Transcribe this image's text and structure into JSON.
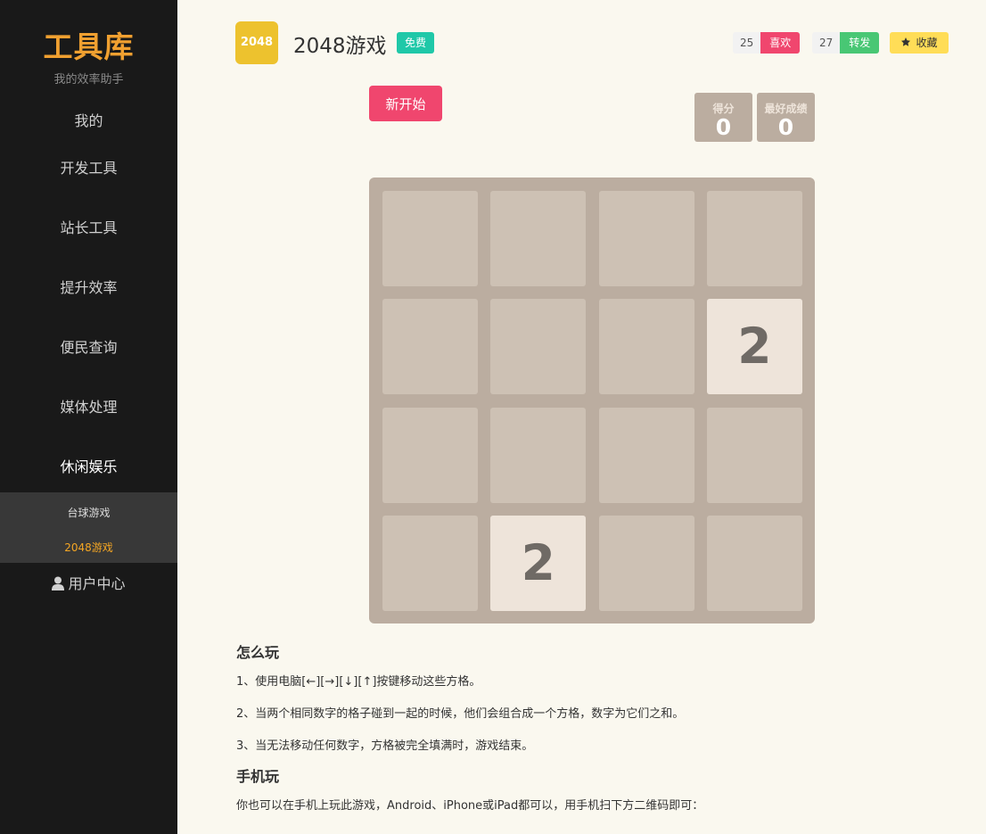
{
  "sidebar": {
    "logo": "工具库",
    "slogan": "我的效率助手",
    "items": [
      {
        "label": "我的"
      },
      {
        "label": "开发工具"
      },
      {
        "label": "站长工具"
      },
      {
        "label": "提升效率"
      },
      {
        "label": "便民查询"
      },
      {
        "label": "媒体处理"
      },
      {
        "label": "休闲娱乐"
      }
    ],
    "subitems": [
      {
        "label": "台球游戏"
      },
      {
        "label": "2048游戏"
      }
    ],
    "user_center": "用户中心"
  },
  "header": {
    "icon_text": "2048",
    "title": "2048游戏",
    "free_badge": "免费",
    "like_count": "25",
    "like_label": "喜欢",
    "share_count": "27",
    "share_label": "转发",
    "favorite_label": "收藏"
  },
  "game": {
    "new_game_label": "新开始",
    "score_label": "得分",
    "score": "0",
    "best_label": "最好成绩",
    "best": "0",
    "grid": [
      [
        0,
        0,
        0,
        0
      ],
      [
        0,
        0,
        0,
        2
      ],
      [
        0,
        0,
        0,
        0
      ],
      [
        0,
        2,
        0,
        0
      ]
    ],
    "colors": {
      "board": "#bbada0",
      "empty_cell": "#cdc1b4",
      "tile_2": "#eee4da",
      "icon": "#edc22e",
      "accent_red": "#f0466e",
      "accent_green": "#48c774",
      "accent_teal": "#1fc8a8",
      "accent_yellow": "#ffdd57"
    }
  },
  "instructions": {
    "how_title": "怎么玩",
    "how_lines": [
      "1、使用电脑[←][→][↓][↑]按键移动这些方格。",
      "2、当两个相同数字的格子碰到一起的时候，他们会组合成一个方格，数字为它们之和。",
      "3、当无法移动任何数字，方格被完全填满时，游戏结束。"
    ],
    "mobile_title": "手机玩",
    "mobile_line": "你也可以在手机上玩此游戏，Android、iPhone或iPad都可以，用手机扫下方二维码即可："
  }
}
